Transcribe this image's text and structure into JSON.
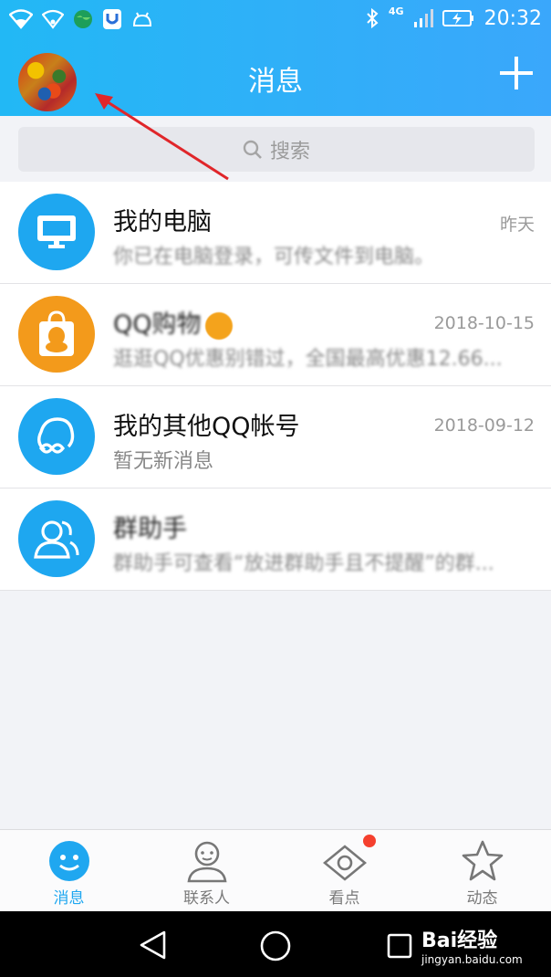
{
  "status_bar": {
    "network": "4G",
    "time": "20:32"
  },
  "header": {
    "title": "消息"
  },
  "search": {
    "placeholder": "搜索"
  },
  "conversations": [
    {
      "title": "我的电脑",
      "subtitle": "你已在电脑登录，可传文件到电脑。",
      "time": "昨天",
      "icon": "computer-icon",
      "color": "#1ea7f0"
    },
    {
      "title": "QQ购物",
      "subtitle": "逛逛QQ优惠别错过，全国最高优惠12.66...",
      "time": "2018-10-15",
      "icon": "shopping-bag-icon",
      "color": "#f39a1b",
      "verified": true
    },
    {
      "title": "我的其他QQ帐号",
      "subtitle": "暂无新消息",
      "time": "2018-09-12",
      "icon": "linked-accounts-icon",
      "color": "#1ea7f0"
    },
    {
      "title": "群助手",
      "subtitle": "群助手可查看“放进群助手且不提醒”的群...",
      "time": "",
      "icon": "group-assistant-icon",
      "color": "#1ea7f0"
    }
  ],
  "tabs": [
    {
      "label": "消息",
      "icon": "message-icon",
      "active": true
    },
    {
      "label": "联系人",
      "icon": "contacts-icon",
      "active": false
    },
    {
      "label": "看点",
      "icon": "eye-icon",
      "active": false,
      "badge": true
    },
    {
      "label": "动态",
      "icon": "star-icon",
      "active": false
    }
  ],
  "watermark": {
    "text": "Bai经验",
    "url": "jingyan.baidu.com"
  },
  "colors": {
    "accent": "#1fa7f0",
    "header_start": "#22b8f5",
    "header_end": "#3aa7fb",
    "badge": "#f5402e"
  }
}
